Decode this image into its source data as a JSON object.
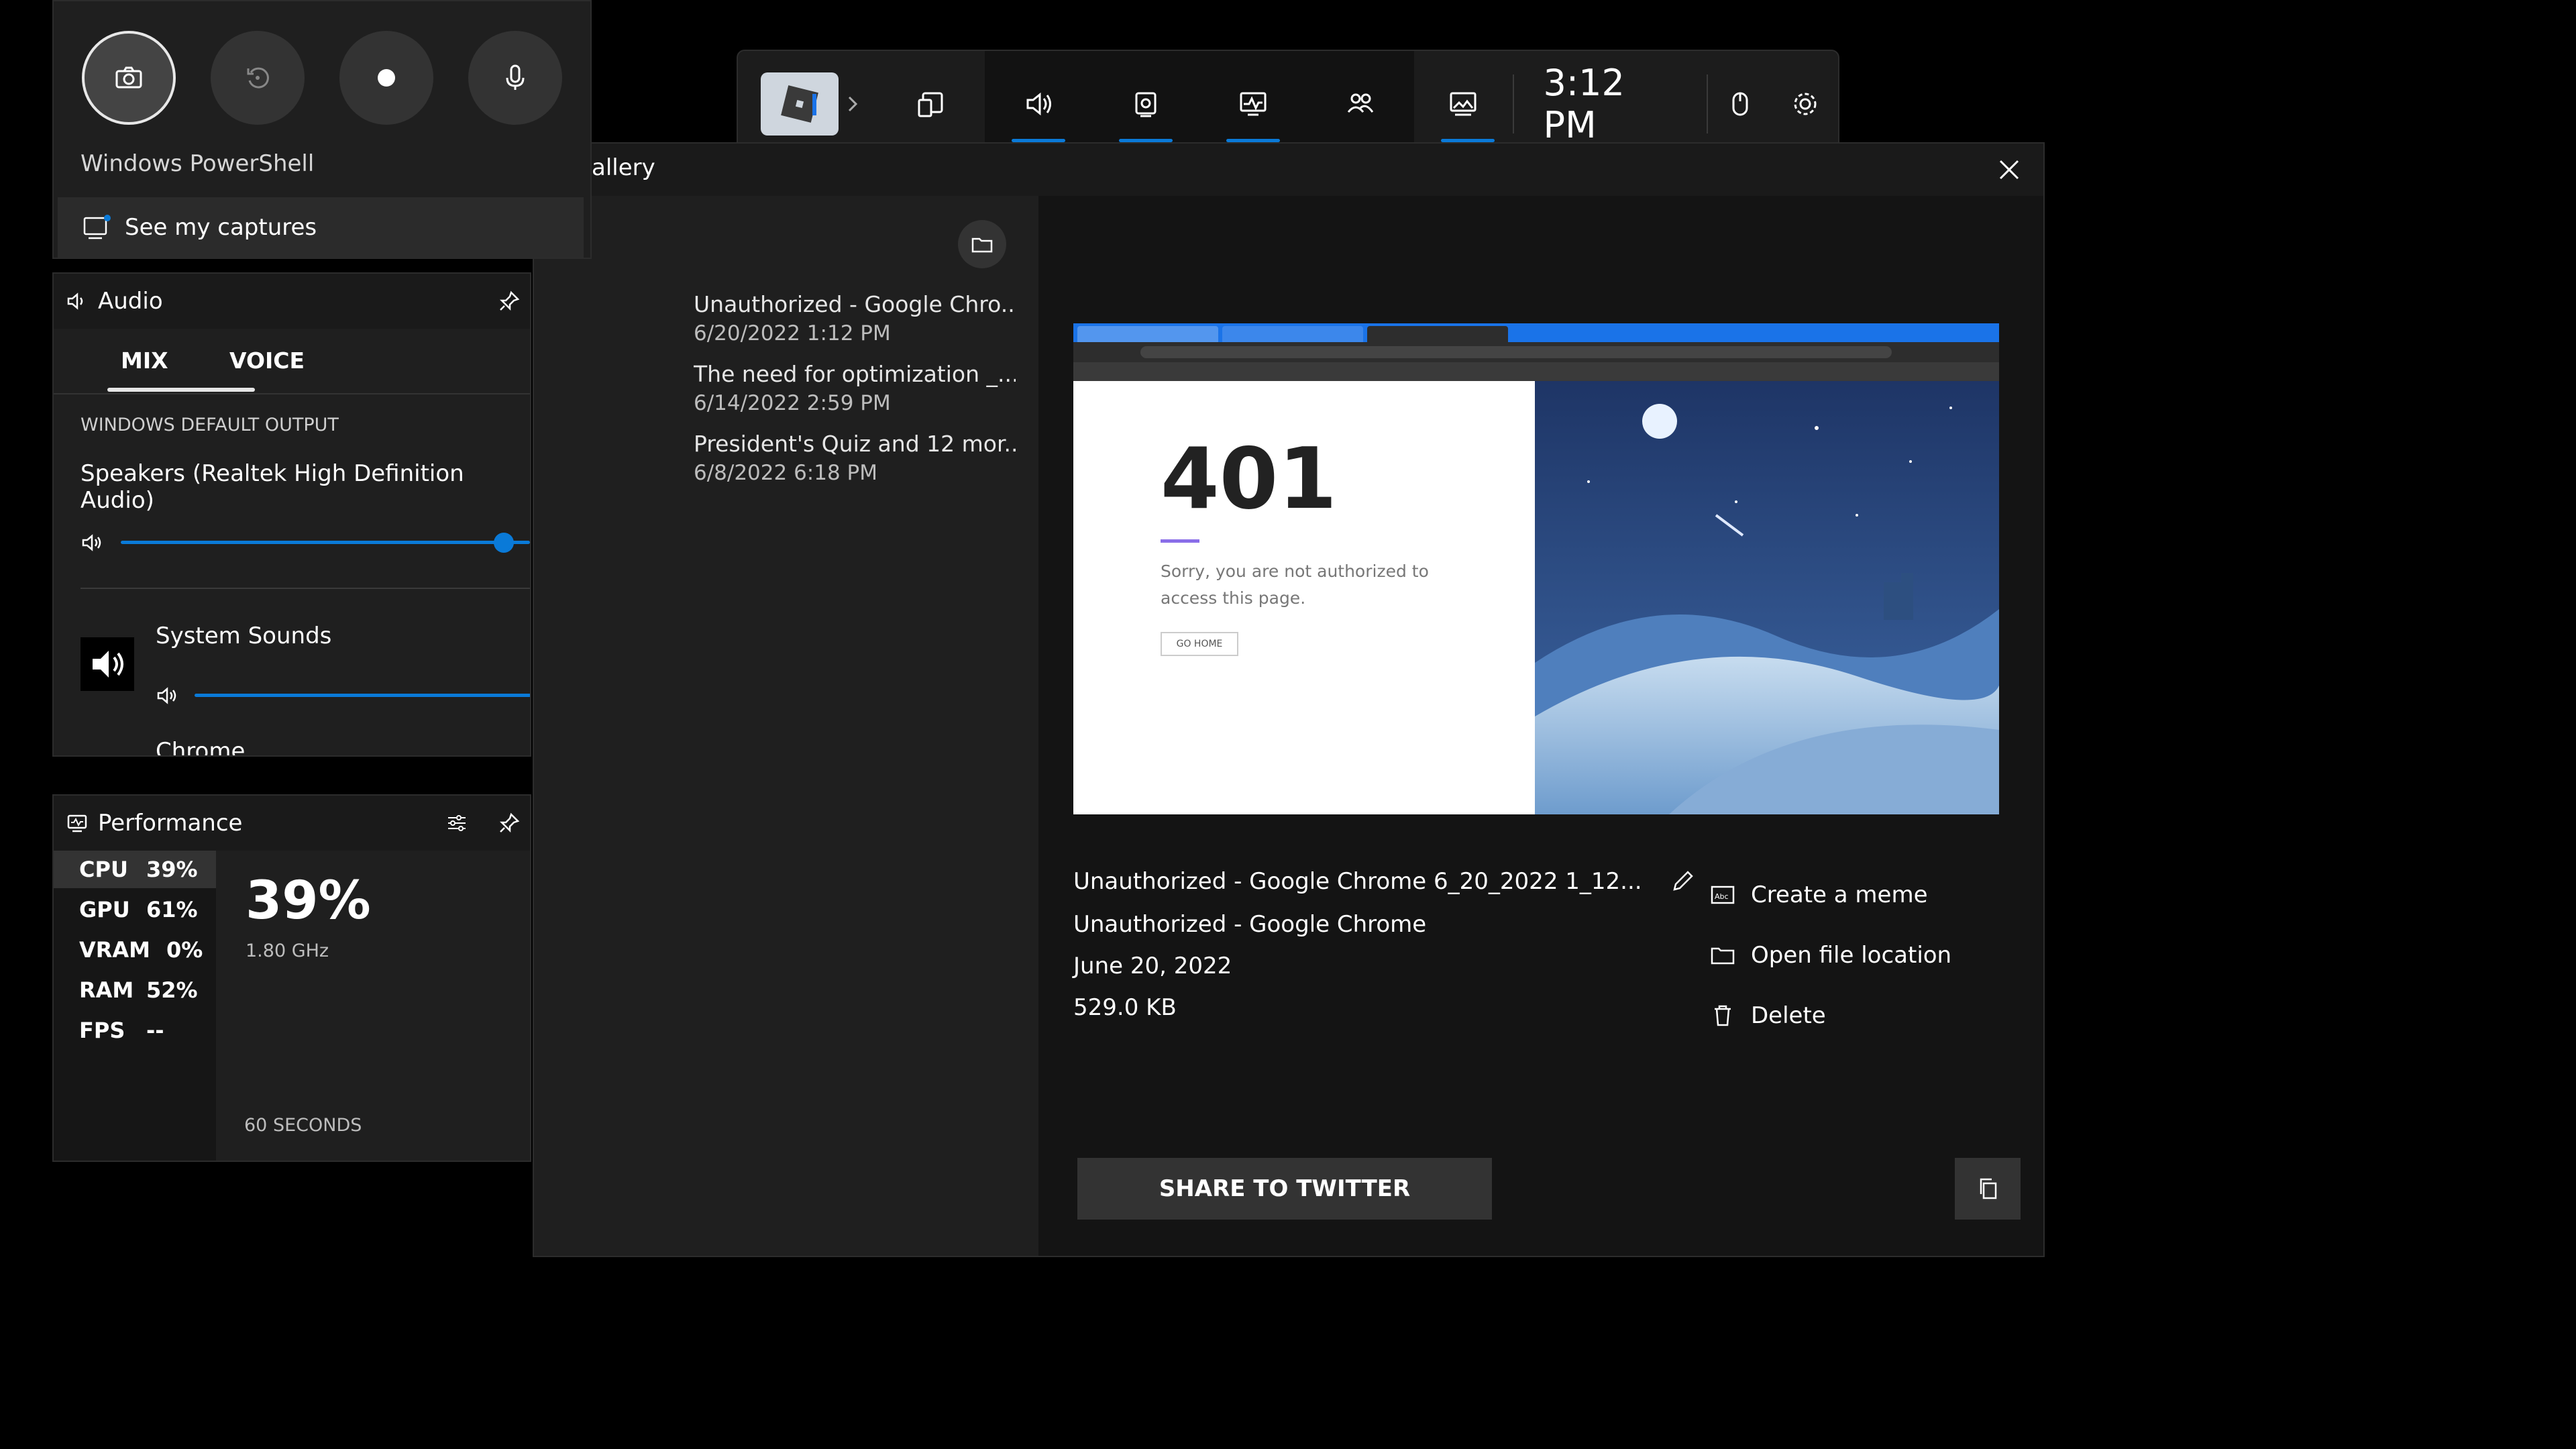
{
  "topbar": {
    "time": "3:12 PM",
    "widgets": [
      "widget-menu",
      "audio",
      "capture",
      "performance",
      "xbox-social",
      "gallery"
    ]
  },
  "capture": {
    "app_title": "Windows PowerShell",
    "see_captures": "See my captures"
  },
  "gallery": {
    "title": "allery",
    "items": [
      {
        "title": "Unauthorized - Google Chro...",
        "date": "6/20/2022 1:12 PM"
      },
      {
        "title": "The need for optimization _...",
        "date": "6/14/2022 2:59 PM"
      },
      {
        "title": "President's Quiz and 12 mor...",
        "date": "6/8/2022 6:18 PM"
      }
    ],
    "preview": {
      "code": "401",
      "message": "Sorry, you are not authorized to access this page.",
      "button": "GO HOME"
    },
    "details": {
      "filename": "Unauthorized - Google Chrome 6_20_2022 1_12...",
      "app": "Unauthorized - Google Chrome",
      "date": "June 20, 2022",
      "size": "529.0 KB"
    },
    "actions": {
      "meme": "Create a meme",
      "open_location": "Open file location",
      "delete": "Delete"
    },
    "share": "SHARE TO TWITTER"
  },
  "audio": {
    "title": "Audio",
    "tabs": [
      "MIX",
      "VOICE"
    ],
    "output_label": "WINDOWS DEFAULT OUTPUT",
    "device": "Speakers (Realtek High Definition Audio)",
    "master_volume_pct": 90,
    "apps": [
      {
        "name": "System Sounds",
        "volume_pct": 100
      },
      {
        "name": "Chrome"
      }
    ]
  },
  "performance": {
    "title": "Performance",
    "metrics": [
      {
        "name": "CPU",
        "value": "39%"
      },
      {
        "name": "GPU",
        "value": "61%"
      },
      {
        "name": "VRAM",
        "value": "0%"
      },
      {
        "name": "RAM",
        "value": "52%"
      },
      {
        "name": "FPS",
        "value": "--"
      }
    ],
    "big_value": "39%",
    "clock": "1.80 GHz",
    "window": "60 SECONDS"
  },
  "colors": {
    "accent": "#0a7ad8",
    "panel": "#1f1f1f",
    "background": "#000000"
  }
}
